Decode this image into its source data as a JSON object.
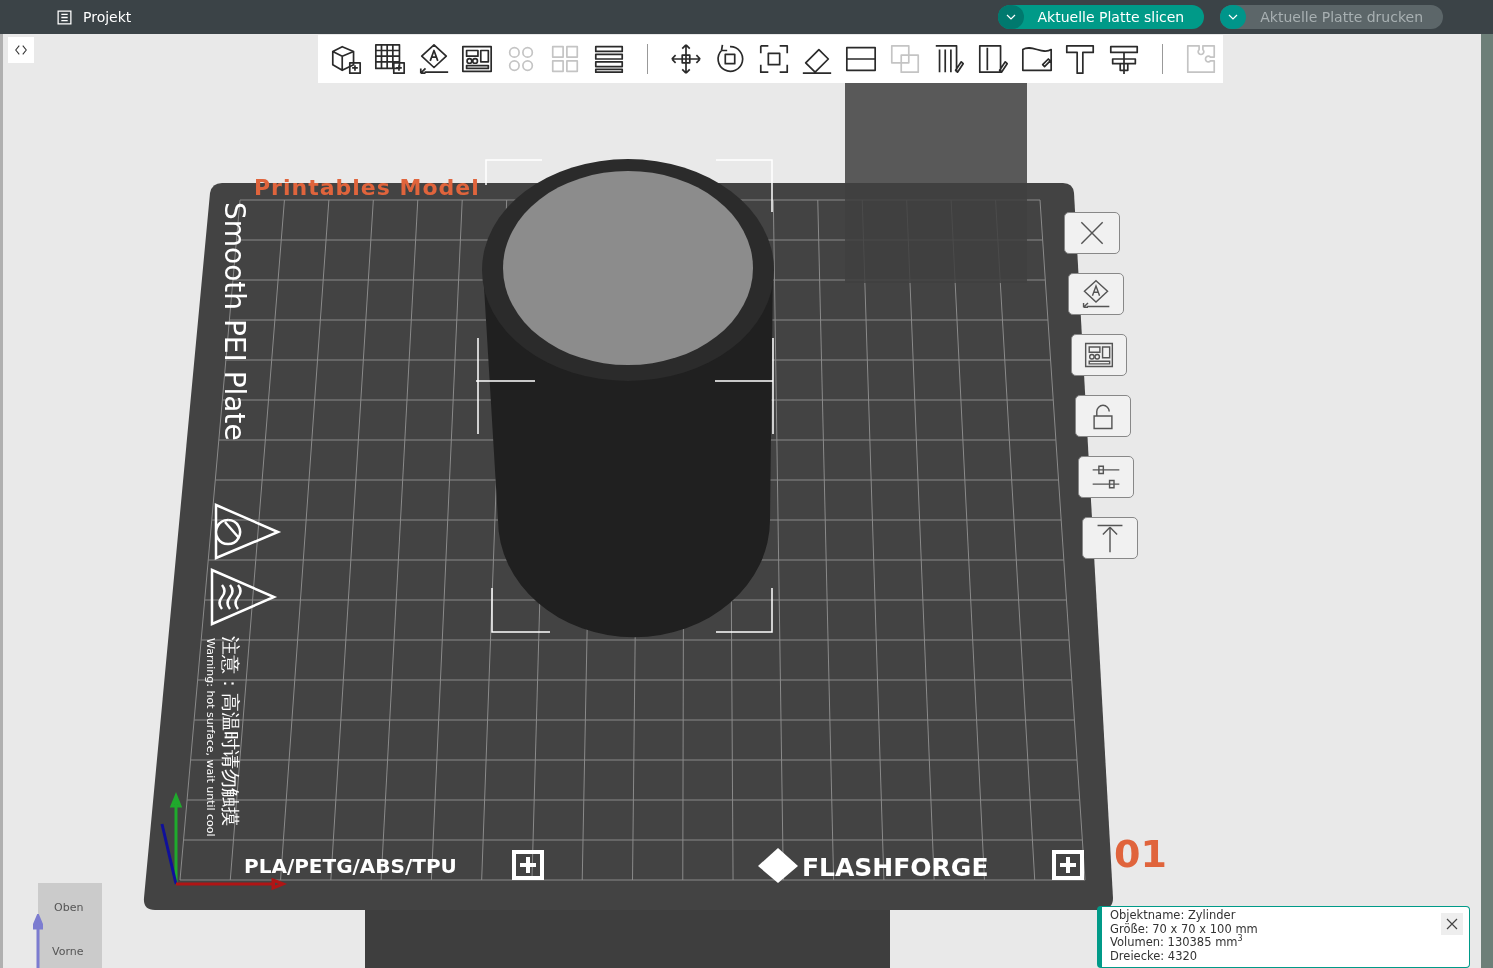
{
  "menu": {
    "label": "Projekt"
  },
  "actions": [
    {
      "label": "Aktuelle Platte slicen",
      "disabled": false
    },
    {
      "label": "Aktuelle Platte drucken",
      "disabled": true
    }
  ],
  "toolbar": {
    "groups": [
      [
        {
          "kind": "add-object",
          "disabled": false
        },
        {
          "kind": "add-plate",
          "disabled": false
        },
        {
          "kind": "auto-orient",
          "disabled": false
        },
        {
          "kind": "arrange",
          "disabled": false
        },
        {
          "kind": "split-objects",
          "disabled": true
        },
        {
          "kind": "split-parts",
          "disabled": true
        },
        {
          "kind": "layers",
          "disabled": false
        }
      ],
      [
        {
          "kind": "move",
          "disabled": false
        },
        {
          "kind": "rotate",
          "disabled": false
        },
        {
          "kind": "scale",
          "disabled": false
        },
        {
          "kind": "flatten",
          "disabled": false
        },
        {
          "kind": "cut",
          "disabled": false
        },
        {
          "kind": "boolean",
          "disabled": true
        },
        {
          "kind": "support",
          "disabled": false
        },
        {
          "kind": "seam",
          "disabled": false
        },
        {
          "kind": "paint",
          "disabled": false
        },
        {
          "kind": "text",
          "disabled": false
        },
        {
          "kind": "measure",
          "disabled": false
        }
      ],
      [
        {
          "kind": "assembly",
          "disabled": true
        }
      ]
    ]
  },
  "plate_tools": [
    {
      "kind": "delete"
    },
    {
      "kind": "auto-orient"
    },
    {
      "kind": "arrange"
    },
    {
      "kind": "lock"
    },
    {
      "kind": "sliders"
    },
    {
      "kind": "upload-top"
    }
  ],
  "plate": {
    "model_label": "Printables Model",
    "surface": "Smooth PEI Plate",
    "warning_cn": "注意：高温时请勿触摸",
    "warning_en": "Warning: hot surface, wait until cool",
    "materials": "PLA/PETG/ABS/TPU",
    "brand": "FLASHFORGE",
    "number": "01"
  },
  "view_cube": {
    "top": "Oben",
    "front": "Vorne"
  },
  "object_info": {
    "lines": [
      "Objektname: Zylinder",
      "Größe: 70 x 70 x 100 mm",
      "Volumen: 130385 mm$^{3}$",
      "Dreiecke: 4320"
    ]
  }
}
